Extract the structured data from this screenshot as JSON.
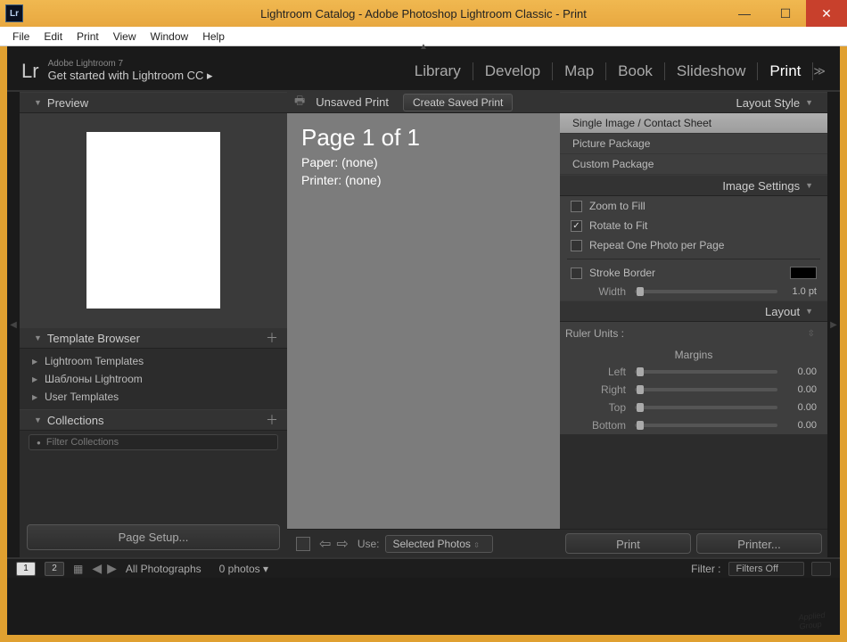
{
  "window": {
    "title": "Lightroom Catalog - Adobe Photoshop Lightroom Classic - Print"
  },
  "menubar": [
    "File",
    "Edit",
    "Print",
    "View",
    "Window",
    "Help"
  ],
  "brand": {
    "logo": "Lr",
    "small": "Adobe Lightroom 7",
    "tagline": "Get started with Lightroom CC  ▸"
  },
  "modules": {
    "items": [
      "Library",
      "Develop",
      "Map",
      "Book",
      "Slideshow",
      "Print"
    ],
    "active": "Print"
  },
  "left": {
    "preview_title": "Preview",
    "template_title": "Template Browser",
    "templates": [
      "Lightroom Templates",
      "Шаблоны Lightroom",
      "User Templates"
    ],
    "collections_title": "Collections",
    "filter_placeholder": "Filter Collections",
    "page_setup": "Page Setup..."
  },
  "center": {
    "top_title": "Unsaved Print",
    "create_btn": "Create Saved Print",
    "page_title": "Page 1 of 1",
    "paper_line": "Paper:  (none)",
    "printer_line": "Printer:  (none)",
    "use_label": "Use:",
    "use_value": "Selected Photos"
  },
  "right": {
    "layout_style_title": "Layout Style",
    "layout_style_opts": [
      "Single Image / Contact Sheet",
      "Picture Package",
      "Custom Package"
    ],
    "image_settings_title": "Image Settings",
    "zoom_to_fill": "Zoom to Fill",
    "rotate_to_fit": "Rotate to Fit",
    "repeat_one": "Repeat One Photo per Page",
    "stroke_border": "Stroke Border",
    "width_label": "Width",
    "width_value": "1.0 pt",
    "layout_title": "Layout",
    "ruler_units": "Ruler Units :",
    "margins_title": "Margins",
    "margin_left_l": "Left",
    "margin_left_v": "0.00",
    "margin_right_l": "Right",
    "margin_right_v": "0.00",
    "margin_top_l": "Top",
    "margin_top_v": "0.00",
    "margin_bottom_l": "Bottom",
    "margin_bottom_v": "0.00",
    "print_btn": "Print",
    "printer_btn": "Printer..."
  },
  "filmstrip": {
    "view1": "1",
    "view2": "2",
    "source": "All Photographs",
    "count": "0 photos",
    "filter_label": "Filter :",
    "filter_value": "Filters Off"
  }
}
